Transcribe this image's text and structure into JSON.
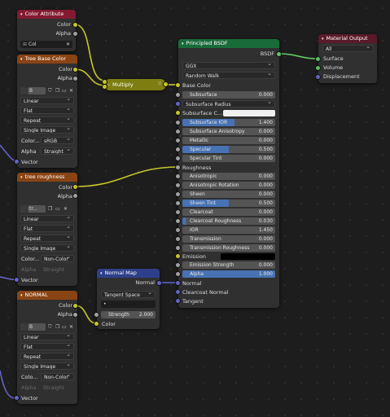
{
  "nodes": {
    "color_attribute": {
      "title": "Color Attribute",
      "outputs": [
        "Color",
        "Alpha"
      ],
      "name_value": "Col"
    },
    "tree_base_color": {
      "title": "Tree Base Color",
      "outputs": [
        "Color",
        "Alpha"
      ],
      "image_name": "B",
      "interpolation": "Linear",
      "projection": "Flat",
      "extension": "Repeat",
      "source": "Single Image",
      "colorspace_label": "Color...",
      "colorspace_value": "sRGB",
      "alpha_label": "Alpha",
      "alpha_value": "Straight",
      "input": "Vector"
    },
    "tree_roughness": {
      "title": "tree roughness",
      "outputs": [
        "Color",
        "Alpha"
      ],
      "image_name": "tr...",
      "interpolation": "Linear",
      "projection": "Flat",
      "extension": "Repeat",
      "source": "Single Image",
      "colorspace_label": "Color...",
      "colorspace_value": "Non-Color",
      "alpha_label": "Alpha",
      "alpha_value": "Straight",
      "input": "Vector"
    },
    "normal": {
      "title": "NORMAL",
      "outputs": [
        "Color",
        "Alpha"
      ],
      "image_name": "B",
      "interpolation": "Linear",
      "projection": "Flat",
      "extension": "Repeat",
      "source": "Single Image",
      "colorspace_label": "Colo...",
      "colorspace_value": "Non-Color",
      "alpha_label": "Alpha",
      "alpha_value": "Straight",
      "input": "Vector"
    },
    "multiply": {
      "title": "Multiply"
    },
    "normal_map": {
      "title": "Normal Map",
      "output": "Normal",
      "space": "Tangent Space",
      "uvmap_glyph": "•",
      "strength_label": "Strength",
      "strength_value": "2.000",
      "input": "Color"
    },
    "principled": {
      "title": "Principled BSDF",
      "output": "BSDF",
      "distribution": "GGX",
      "subsurface_method": "Random Walk",
      "base_color": "Base Color",
      "subsurface": {
        "label": "Subsurface",
        "value": "0.000"
      },
      "subsurface_radius": "Subsurface Radius",
      "subsurface_color": "Subsurface C...",
      "subsurface_color_value": "#f0f0f0",
      "subsurface_ior": {
        "label": "Subsurface IOR",
        "value": "1.400",
        "fill": 0.56
      },
      "subsurface_anisotropy": {
        "label": "Subsurface Anisotropy",
        "value": "0.000"
      },
      "metallic": {
        "label": "Metallic",
        "value": "0.000"
      },
      "specular": {
        "label": "Specular",
        "value": "0.500",
        "fill": 0.5
      },
      "specular_tint": {
        "label": "Specular Tint",
        "value": "0.000"
      },
      "roughness": "Roughness",
      "anisotropic": {
        "label": "Anisotropic",
        "value": "0.000"
      },
      "anisotropic_rotation": {
        "label": "Anisotropic Rotation",
        "value": "0.000"
      },
      "sheen": {
        "label": "Sheen",
        "value": "0.000"
      },
      "sheen_tint": {
        "label": "Sheen Tint",
        "value": "0.500",
        "fill": 0.5
      },
      "clearcoat": {
        "label": "Clearcoat",
        "value": "0.000"
      },
      "clearcoat_roughness": {
        "label": "Clearcoat Roughness",
        "value": "0.030",
        "fill": 0.03
      },
      "ior": {
        "label": "IOR",
        "value": "1.450"
      },
      "transmission": {
        "label": "Transmission",
        "value": "0.000"
      },
      "transmission_roughness": {
        "label": "Transmission Roughness",
        "value": "0.000"
      },
      "emission": "Emission",
      "emission_color": "#000000",
      "emission_strength": {
        "label": "Emission Strength",
        "value": "0.000"
      },
      "alpha": {
        "label": "Alpha",
        "value": "1.000",
        "fill": 1.0
      },
      "normal": "Normal",
      "clearcoat_normal": "Clearcoat Normal",
      "tangent": "Tangent"
    },
    "material_output": {
      "title": "Material Output",
      "target": "All",
      "inputs": [
        "Surface",
        "Volume",
        "Displacement"
      ]
    }
  },
  "colors": {
    "color_socket": "#c7c729",
    "float_socket": "#a1a1a1",
    "vector_socket": "#6363c7",
    "shader_socket": "#63c763",
    "accent": "#4772b3"
  }
}
